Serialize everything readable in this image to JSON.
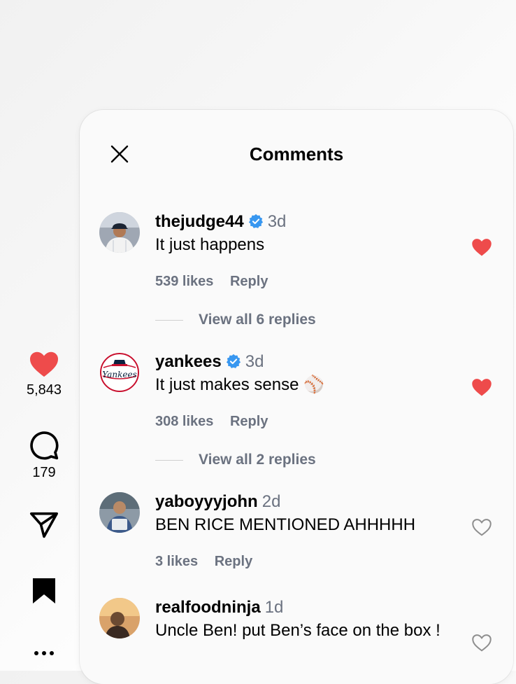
{
  "rail": {
    "likes": "5,843",
    "comments": "179",
    "icons": [
      "heart-filled-icon",
      "comment-icon",
      "share-icon",
      "bookmark-icon",
      "more-icon"
    ],
    "colors": {
      "like": "#ee4b4b",
      "icon": "#000000"
    }
  },
  "panel": {
    "title": "Comments",
    "close_icon": "close-icon"
  },
  "comments": [
    {
      "user": "thejudge44",
      "verified": true,
      "time": "3d",
      "text": "It just happens",
      "likes": "539 likes",
      "reply": "Reply",
      "liked": true,
      "view_replies": "View all 6 replies"
    },
    {
      "user": "yankees",
      "verified": true,
      "time": "3d",
      "text": "It just makes sense ⚾",
      "likes": "308 likes",
      "reply": "Reply",
      "liked": true,
      "view_replies": "View all 2 replies"
    },
    {
      "user": "yaboyyyjohn",
      "verified": false,
      "time": "2d",
      "text": "BEN RICE MENTIONED AHHHHH",
      "likes": "3 likes",
      "reply": "Reply",
      "liked": false
    },
    {
      "user": "realfoodninja",
      "verified": false,
      "time": "1d",
      "text": "Uncle Ben! put Ben’s face on the box !",
      "liked": false
    }
  ],
  "colors": {
    "verified": "#3897f0",
    "liked_heart": "#ee4b4b",
    "muted_text": "#6b7280"
  }
}
